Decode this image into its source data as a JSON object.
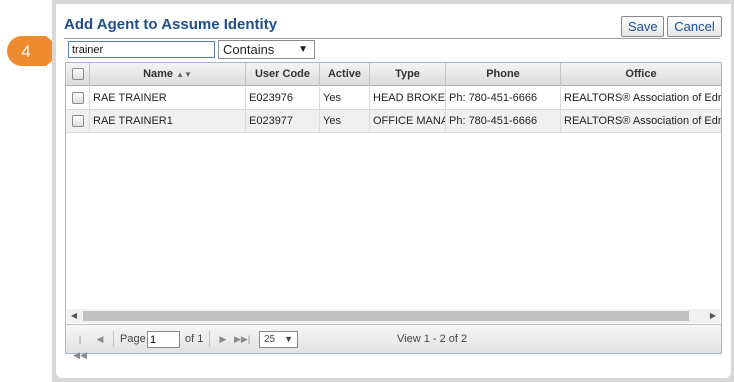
{
  "dialog": {
    "title": "Add Agent to Assume Identity",
    "save_label": "Save",
    "cancel_label": "Cancel"
  },
  "callout": {
    "number": "4",
    "color": "#f08a2e"
  },
  "search": {
    "value": "trainer",
    "match_mode": "Contains"
  },
  "grid": {
    "columns": [
      "Name",
      "User Code",
      "Active",
      "Type",
      "Phone",
      "Office"
    ],
    "rows": [
      [
        "RAE TRAINER",
        "E023976",
        "Yes",
        "HEAD BROKER",
        "Ph: 780-451-6666",
        "REALTORS® Association of Edm"
      ],
      [
        "RAE TRAINER1",
        "E023977",
        "Yes",
        "OFFICE MANAGER",
        "Ph: 780-451-6666",
        "REALTORS® Association of Edm"
      ]
    ]
  },
  "pager": {
    "page_label": "Page",
    "page_value": "1",
    "of_label": "of 1",
    "page_size": "25",
    "summary": "View 1 - 2 of 2"
  },
  "icons": {
    "sort": "sort-icon",
    "first": "first-page-icon",
    "prev": "prev-page-icon",
    "next": "next-page-icon",
    "last": "last-page-icon"
  }
}
